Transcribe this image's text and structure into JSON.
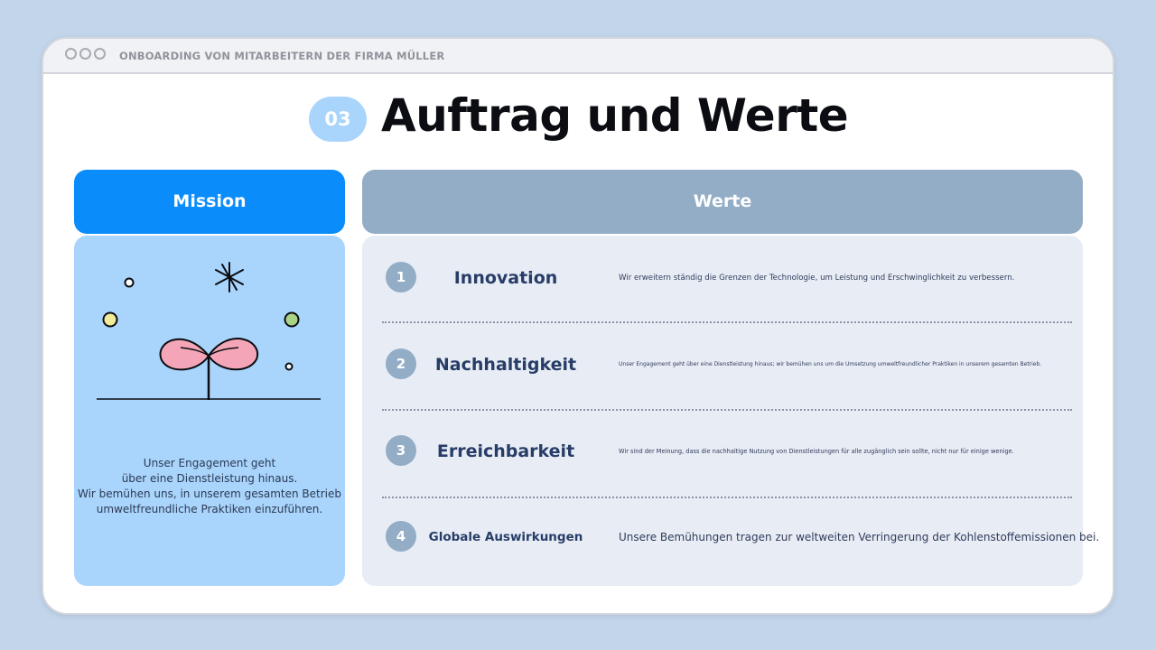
{
  "window": {
    "title": "ONBOARDING VON MITARBEITERN DER FIRMA MÜLLER"
  },
  "header": {
    "badge": "03",
    "title": "Auftrag und Werte"
  },
  "mission": {
    "heading": "Mission",
    "illustration": "sprout-illustration",
    "text_lines": [
      "Unser Engagement geht",
      "über eine Dienstleistung hinaus.",
      "Wir bemühen uns, in unserem gesamten Betrieb",
      "umweltfreundliche Praktiken einzuführen."
    ]
  },
  "werte": {
    "heading": "Werte",
    "items": [
      {
        "number": "1",
        "name": "Innovation",
        "description": "Wir erweitern ständig die Grenzen der Technologie, um Leistung und Erschwinglichkeit zu verbessern."
      },
      {
        "number": "2",
        "name": "Nachhaltigkeit",
        "description": "Unser Engagement geht über eine Dienstleistung hinaus; wir bemühen uns um die Umsetzung umweltfreundlicher Praktiken in unserem gesamten Betrieb."
      },
      {
        "number": "3",
        "name": "Erreichbarkeit",
        "description": "Wir sind der Meinung, dass die nachhaltige Nutzung von Dienstleistungen für alle zugänglich sein sollte, nicht nur für einige wenige."
      },
      {
        "number": "4",
        "name": "Globale Auswirkungen",
        "description": "Unsere Bemühungen tragen zur weltweiten Verringerung der Kohlenstoffemissionen bei."
      }
    ]
  },
  "colors": {
    "background": "#c3d5ea",
    "mission_header": "#0a8dfa",
    "mission_body": "#a9d4fb",
    "werte_header": "#93adc6",
    "werte_body": "#e8ecf5",
    "value_title": "#273d67",
    "petal": "#f4a6b8"
  }
}
